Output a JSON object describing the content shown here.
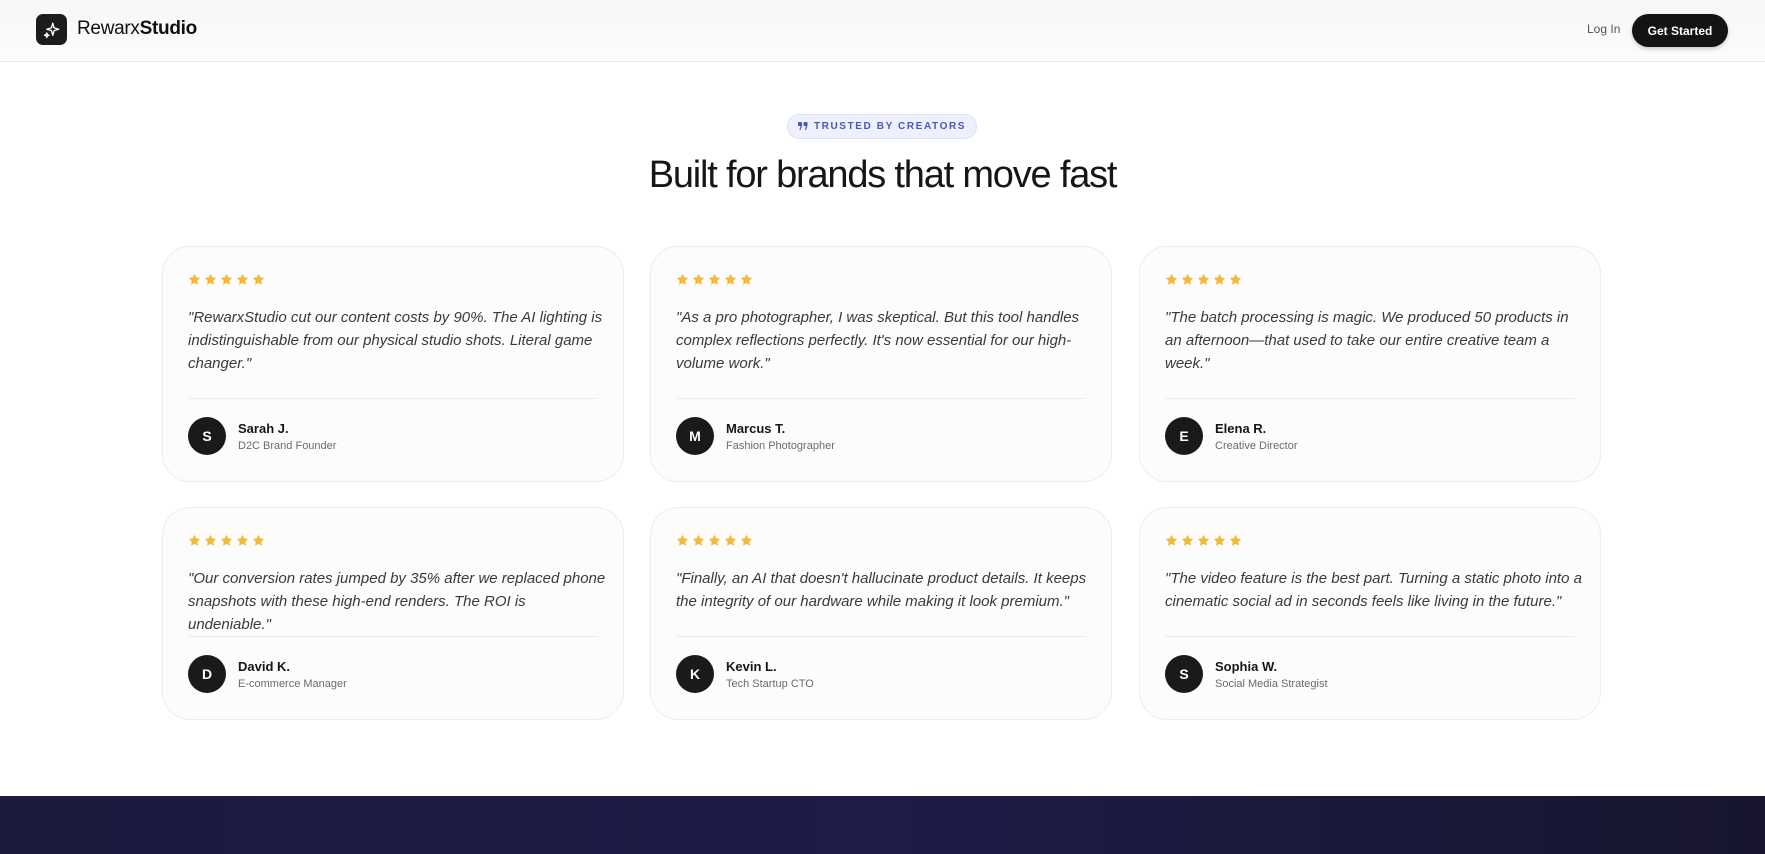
{
  "header": {
    "logo_icon": "sparkle-icon",
    "brand_regular": "Rewarx",
    "brand_bold": "Studio",
    "login_label": "Log In",
    "cta_label": "Get Started"
  },
  "section": {
    "badge_icon": "quote-icon",
    "badge_label": "TRUSTED BY CREATORS",
    "title": "Built for brands that move fast"
  },
  "colors": {
    "star": "#f5b93a",
    "badge_text": "#4a55c9",
    "cta_bg": "#141414",
    "footer_band": "#1c1a3e"
  },
  "testimonials": [
    {
      "rating": 5,
      "quote": "\"RewarxStudio cut our content costs by 90%. The AI lighting is indistinguishable from our physical studio shots. Literal game changer.\"",
      "initial": "S",
      "name": "Sarah J.",
      "role": "D2C Brand Founder"
    },
    {
      "rating": 5,
      "quote": "\"As a pro photographer, I was skeptical. But this tool handles complex reflections perfectly. It's now essential for our high-volume work.\"",
      "initial": "M",
      "name": "Marcus T.",
      "role": "Fashion Photographer"
    },
    {
      "rating": 5,
      "quote": "\"The batch processing is magic. We produced 50 products in an afternoon—that used to take our entire creative team a week.\"",
      "initial": "E",
      "name": "Elena R.",
      "role": "Creative Director"
    },
    {
      "rating": 5,
      "quote": "\"Our conversion rates jumped by 35% after we replaced phone snapshots with these high-end renders. The ROI is undeniable.\"",
      "initial": "D",
      "name": "David K.",
      "role": "E-commerce Manager"
    },
    {
      "rating": 5,
      "quote": "\"Finally, an AI that doesn't hallucinate product details. It keeps the integrity of our hardware while making it look premium.\"",
      "initial": "K",
      "name": "Kevin L.",
      "role": "Tech Startup CTO"
    },
    {
      "rating": 5,
      "quote": "\"The video feature is the best part. Turning a static photo into a cinematic social ad in seconds feels like living in the future.\"",
      "initial": "S",
      "name": "Sophia W.",
      "role": "Social Media Strategist"
    }
  ]
}
